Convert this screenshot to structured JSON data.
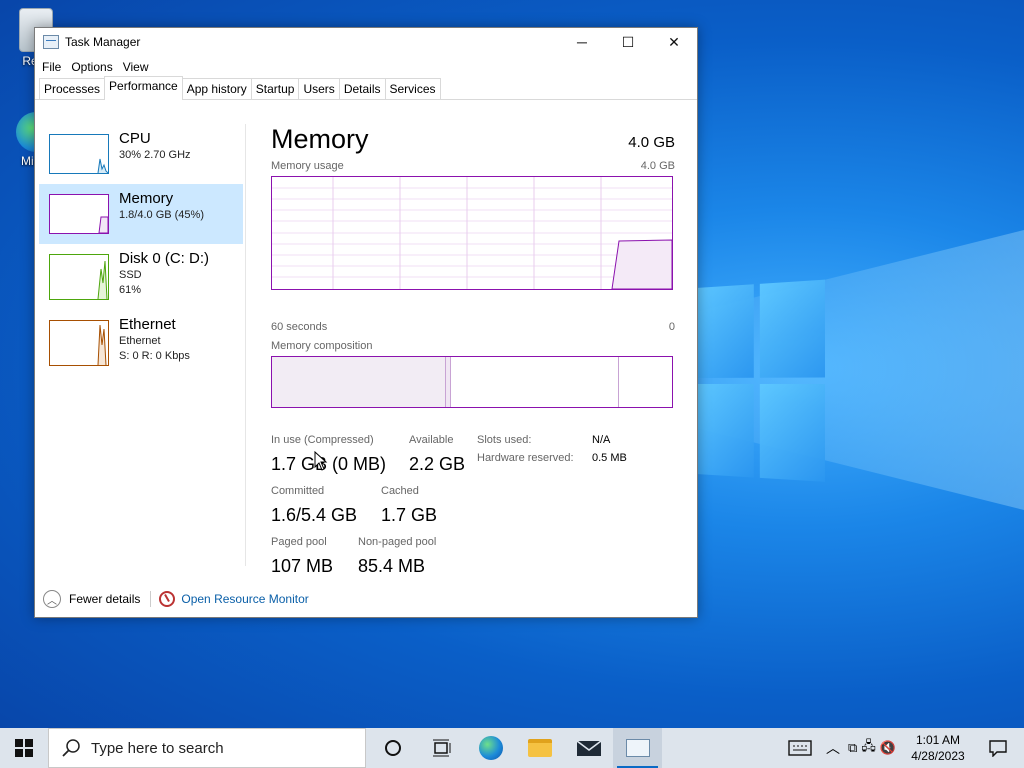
{
  "desktop": {
    "icons": [
      {
        "label": "Recy",
        "icon": "recycle-bin-icon"
      },
      {
        "label": "Mic E",
        "icon": "edge-icon"
      }
    ]
  },
  "window": {
    "title": "Task Manager",
    "controls": {
      "minimize": "─",
      "maximize": "☐",
      "close": "✕"
    },
    "menu": [
      "File",
      "Options",
      "View"
    ],
    "tabs": [
      "Processes",
      "Performance",
      "App history",
      "Startup",
      "Users",
      "Details",
      "Services"
    ],
    "active_tab": "Performance"
  },
  "sidebar": {
    "items": [
      {
        "title": "CPU",
        "sub1": "30%  2.70 GHz",
        "sub2": "",
        "sub3": "",
        "color": "#1779ba"
      },
      {
        "title": "Memory",
        "sub1": "1.8/4.0 GB (45%)",
        "sub2": "",
        "sub3": "",
        "color": "#8b12ae"
      },
      {
        "title": "Disk 0 (C: D:)",
        "sub1": "SSD",
        "sub2": "61%",
        "sub3": "",
        "color": "#4da60c"
      },
      {
        "title": "Ethernet",
        "sub1": "Ethernet",
        "sub2": "S: 0  R: 0 Kbps",
        "sub3": "",
        "color": "#a74f01"
      }
    ],
    "selected": "Memory"
  },
  "main": {
    "title": "Memory",
    "total": "4.0 GB",
    "usage_label": "Memory usage",
    "usage_max": "4.0 GB",
    "time_left": "60 seconds",
    "time_right": "0",
    "composition_label": "Memory composition",
    "stats": {
      "in_use_label": "In use (Compressed)",
      "in_use_value": "1.7 GB (0 MB)",
      "available_label": "Available",
      "available_value": "2.2 GB",
      "slots_label": "Slots used:",
      "slots_value": "N/A",
      "hw_label": "Hardware reserved:",
      "hw_value": "0.5 MB",
      "committed_label": "Committed",
      "committed_value": "1.6/5.4 GB",
      "cached_label": "Cached",
      "cached_value": "1.7 GB",
      "paged_label": "Paged pool",
      "paged_value": "107 MB",
      "nonpaged_label": "Non-paged pool",
      "nonpaged_value": "85.4 MB"
    },
    "accent": "#8b12ae"
  },
  "footer": {
    "fewer_details": "Fewer details",
    "resource_monitor": "Open Resource Monitor"
  },
  "taskbar": {
    "search_placeholder": "Type here to search",
    "time": "1:01 AM",
    "date": "4/28/2023"
  }
}
